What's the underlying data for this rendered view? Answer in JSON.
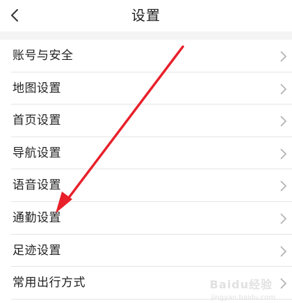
{
  "header": {
    "title": "设置",
    "back_icon": "chevron-left-icon"
  },
  "settings": {
    "items": [
      {
        "label": "账号与安全"
      },
      {
        "label": "地图设置"
      },
      {
        "label": "首页设置"
      },
      {
        "label": "导航设置"
      },
      {
        "label": "语音设置"
      },
      {
        "label": "通勤设置"
      },
      {
        "label": "足迹设置"
      },
      {
        "label": "常用出行方式"
      }
    ],
    "chevron_icon": "chevron-right-icon"
  },
  "annotation": {
    "color": "#e8202a",
    "target_item": "通勤设置"
  },
  "watermark": {
    "text": "Baidu经验",
    "sub": "jingyan.baidu.com"
  },
  "colors": {
    "background": "#f4f4f4",
    "surface": "#ffffff",
    "text": "#222222",
    "divider": "#e3e3e3",
    "chevron": "#b0b0b0"
  }
}
